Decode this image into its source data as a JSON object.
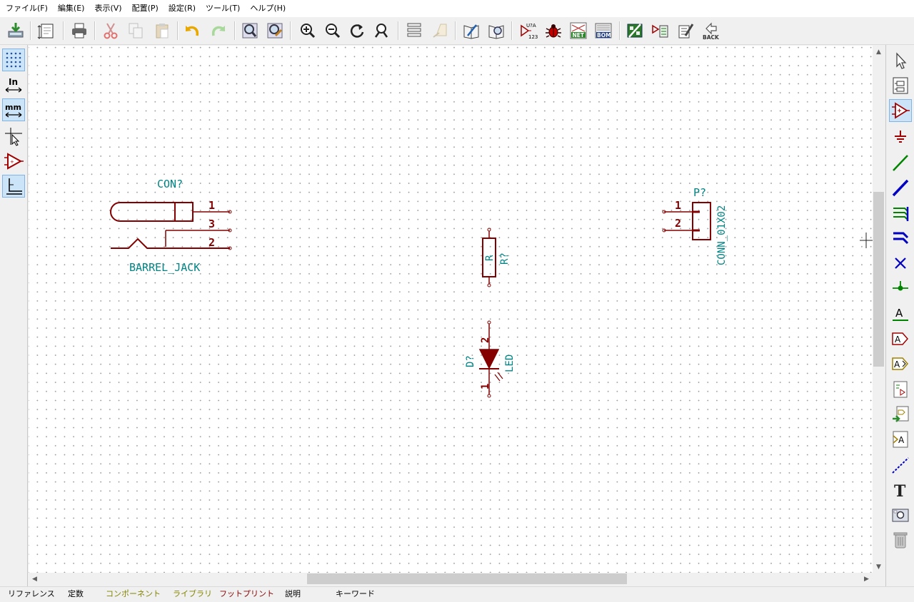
{
  "menu": [
    "ファイル(F)",
    "編集(E)",
    "表示(V)",
    "配置(P)",
    "設定(R)",
    "ツール(T)",
    "ヘルプ(H)"
  ],
  "toolbar": {
    "icons": [
      "save-icon",
      "page-settings-icon",
      "print-icon",
      "cut-icon",
      "copy-icon",
      "paste-icon",
      "undo-icon",
      "redo-icon",
      "find-icon",
      "find-replace-icon",
      "zoom-in-icon",
      "zoom-out-icon",
      "zoom-redraw-icon",
      "zoom-fit-icon",
      "hierarchy-navigator-icon",
      "leave-sheet-icon",
      "library-editor-icon",
      "library-browser-icon",
      "annotate-icon",
      "erc-icon",
      "netlist-icon",
      "bom-icon",
      "cvpcb-icon",
      "import-footprint-icon",
      "pcbnew-icon",
      "back-annotate-icon"
    ],
    "u2a_label": "U?A",
    "u2a_sub": "123",
    "net_label": "NET",
    "bom_label": "BOM",
    "back_label": "BACK"
  },
  "left_toolbar": {
    "inch_label": "In",
    "mm_label": "mm"
  },
  "right_toolbar": {
    "text_tool_label": "T"
  },
  "schematic": {
    "colors": {
      "body": "#840000",
      "field": "#008484",
      "wire": "#008400",
      "bus": "#0000c2"
    },
    "barrel_jack": {
      "ref": "CON?",
      "value": "BARREL_JACK",
      "pins": [
        "1",
        "3",
        "2"
      ]
    },
    "resistor": {
      "ref": "R?",
      "value": "R"
    },
    "led": {
      "ref": "D?",
      "value": "LED",
      "pins": [
        "2",
        "1"
      ]
    },
    "connector": {
      "ref": "P?",
      "value": "CONN_01X02",
      "pins": [
        "1",
        "2"
      ]
    }
  },
  "status_bar": [
    "リファレンス",
    "定数",
    "コンポーネント",
    "ライブラリ",
    "フットプリント",
    "説明",
    "キーワード"
  ],
  "status_colors": {
    "default": "#000000",
    "component": "#848400",
    "library": "#848400",
    "footprint": "#840000"
  }
}
